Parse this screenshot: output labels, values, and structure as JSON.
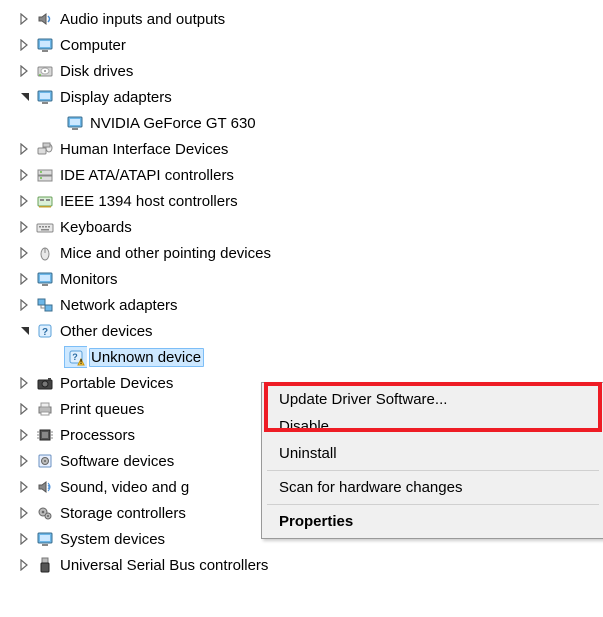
{
  "tree": {
    "audio": {
      "label": "Audio inputs and outputs",
      "expanded": false
    },
    "computer": {
      "label": "Computer",
      "expanded": false
    },
    "disk": {
      "label": "Disk drives",
      "expanded": false
    },
    "display": {
      "label": "Display adapters",
      "expanded": true,
      "children": {
        "nvidia": {
          "label": "NVIDIA GeForce GT 630"
        }
      }
    },
    "hid": {
      "label": "Human Interface Devices",
      "expanded": false
    },
    "ide": {
      "label": "IDE ATA/ATAPI controllers",
      "expanded": false
    },
    "ieee": {
      "label": "IEEE 1394 host controllers",
      "expanded": false
    },
    "keyboards": {
      "label": "Keyboards",
      "expanded": false
    },
    "mice": {
      "label": "Mice and other pointing devices",
      "expanded": false
    },
    "monitors": {
      "label": "Monitors",
      "expanded": false
    },
    "network": {
      "label": "Network adapters",
      "expanded": false
    },
    "other": {
      "label": "Other devices",
      "expanded": true,
      "children": {
        "unknown": {
          "label": "Unknown device",
          "selected": true
        }
      }
    },
    "portable": {
      "label": "Portable Devices",
      "expanded": false
    },
    "print": {
      "label": "Print queues",
      "expanded": false
    },
    "processors": {
      "label": "Processors",
      "expanded": false
    },
    "software": {
      "label": "Software devices",
      "expanded": false
    },
    "sound": {
      "label": "Sound, video and game controllers",
      "truncated_label": "Sound, video and g",
      "expanded": false
    },
    "storage": {
      "label": "Storage controllers",
      "expanded": false
    },
    "system": {
      "label": "System devices",
      "expanded": false
    },
    "usb": {
      "label": "Universal Serial Bus controllers",
      "expanded": false
    }
  },
  "context_menu": {
    "update": "Update Driver Software...",
    "disable": "Disable",
    "uninstall": "Uninstall",
    "scan": "Scan for hardware changes",
    "properties": "Properties"
  }
}
